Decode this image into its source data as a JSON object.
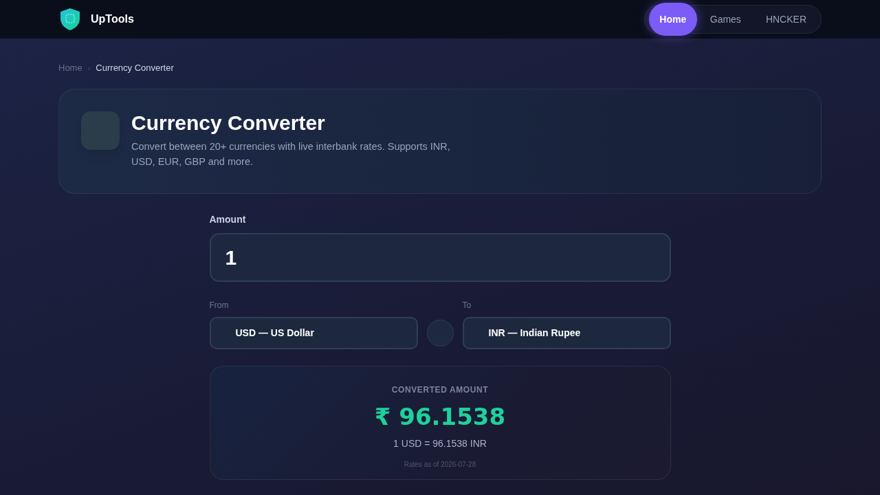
{
  "header": {
    "logo_text": "UpTools",
    "nav": [
      {
        "label": "Home",
        "selected": true
      },
      {
        "label": "Games",
        "selected": false
      },
      {
        "label": "HNCKER",
        "selected": false
      }
    ]
  },
  "breadcrumb": {
    "items": [
      "Home",
      "Currency Converter"
    ],
    "separator": "›"
  },
  "hero": {
    "title": "Currency Converter",
    "description": "Convert between 20+ currencies with live interbank rates. Supports INR, USD, EUR, GBP and more."
  },
  "converter": {
    "amount": {
      "label": "Amount",
      "value": "1"
    },
    "from": {
      "label": "From",
      "value": "USD — US Dollar"
    },
    "to": {
      "label": "To",
      "value": "INR — Indian Rupee"
    }
  },
  "result": {
    "label": "CONVERTED AMOUNT",
    "value": "₹ 96.1538",
    "rate": "1 USD = 96.1538 INR",
    "updated": "Rates as of 2026-07-28"
  }
}
